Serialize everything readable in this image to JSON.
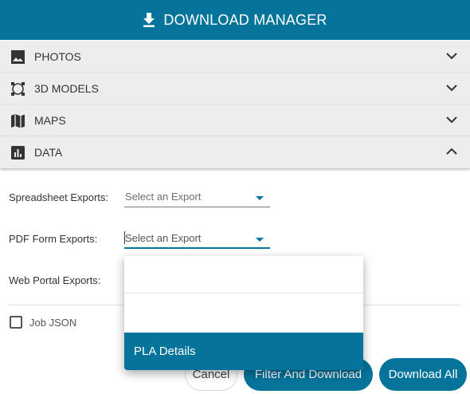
{
  "header": {
    "title": "DOWNLOAD MANAGER",
    "icon": "download-icon"
  },
  "accordion": [
    {
      "label": "PHOTOS",
      "icon": "image-icon",
      "expanded": false
    },
    {
      "label": "3D MODELS",
      "icon": "3d-rotate-icon",
      "expanded": false
    },
    {
      "label": "MAPS",
      "icon": "map-icon",
      "expanded": false
    },
    {
      "label": "DATA",
      "icon": "bar-chart-icon",
      "expanded": true
    }
  ],
  "data_section": {
    "spreadsheet": {
      "label": "Spreadsheet Exports:",
      "placeholder": "Select an Export"
    },
    "pdf": {
      "label": "PDF Form Exports:",
      "placeholder": "Select an Export"
    },
    "web": {
      "label": "Web Portal Exports:"
    },
    "job_json": {
      "label": "Job JSON",
      "checked": false
    }
  },
  "dropdown": {
    "options": [
      "",
      "",
      "PLA Details"
    ],
    "highlighted_index": 2
  },
  "buttons": {
    "cancel": "Cancel",
    "filter": "Filter And Download",
    "download": "Download All"
  },
  "colors": {
    "accent": "#05749a",
    "panel": "#ededed"
  }
}
